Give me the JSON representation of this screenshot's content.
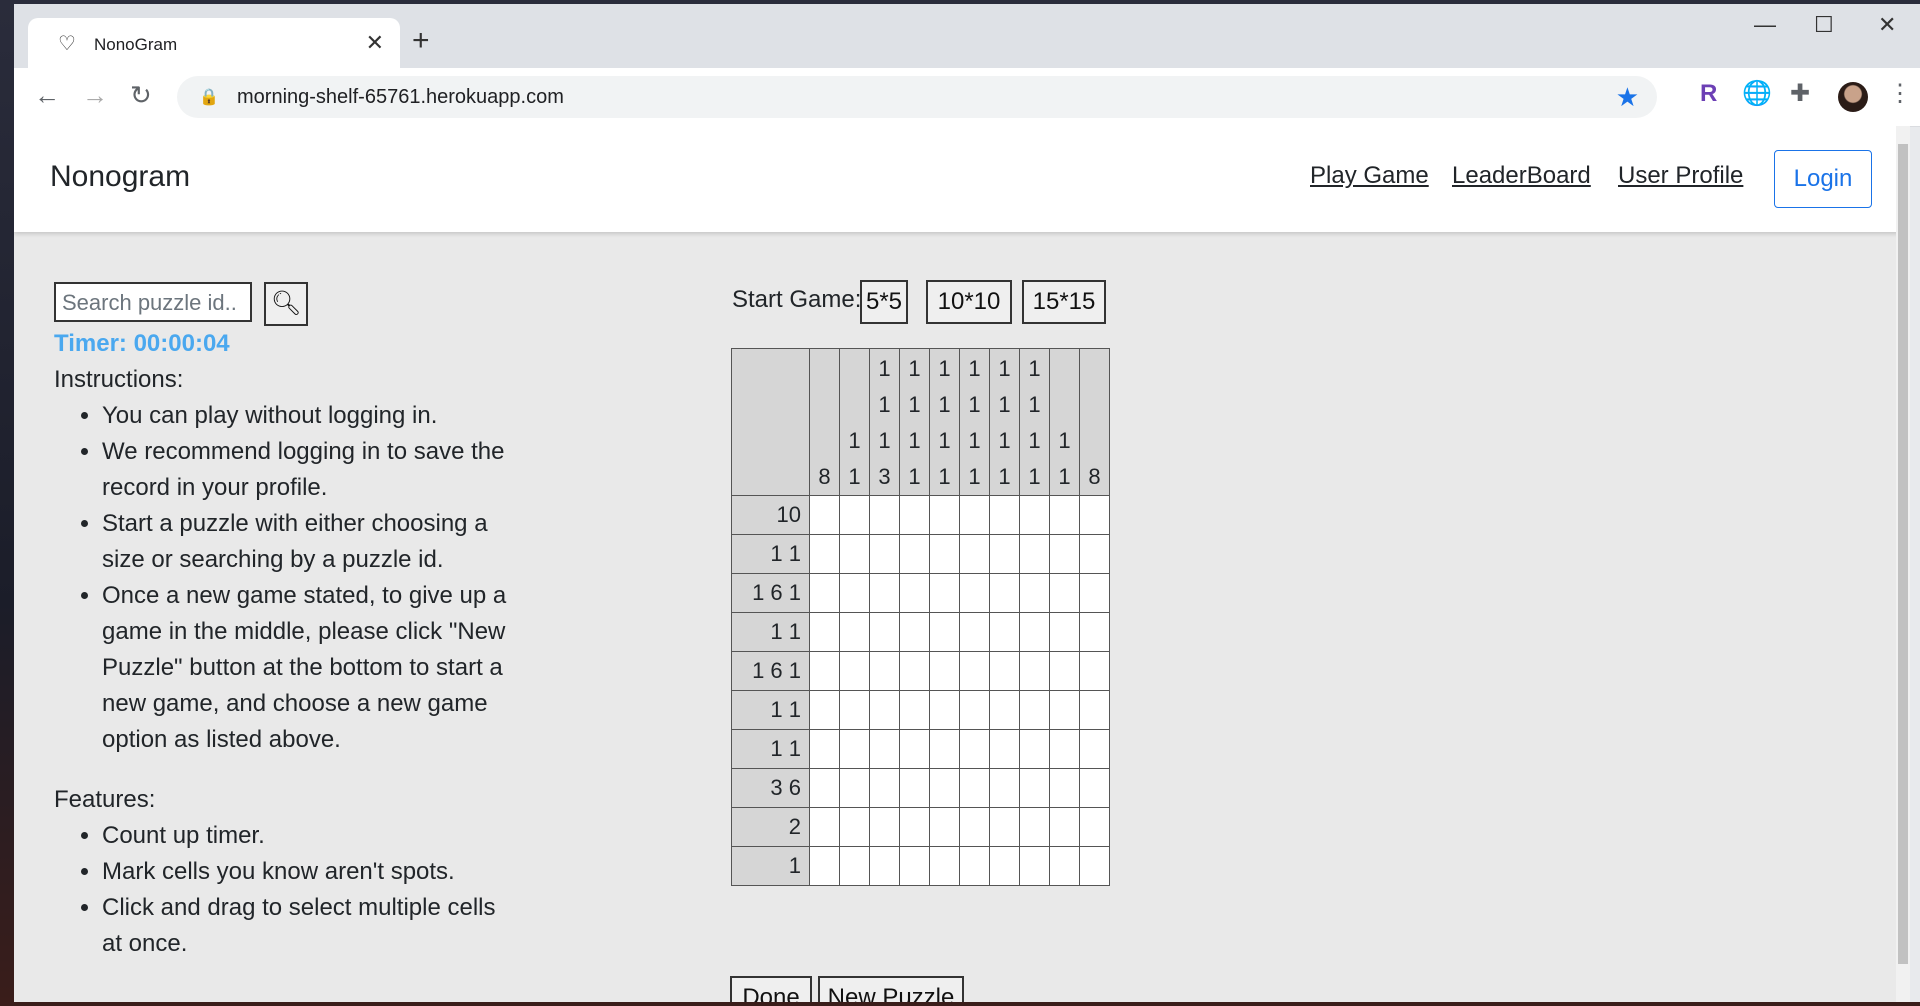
{
  "browser": {
    "tab_title": "NonoGram",
    "url": "morning-shelf-65761.herokuapp.com"
  },
  "navbar": {
    "brand": "Nonogram",
    "links": [
      "Play Game",
      "LeaderBoard",
      "User Profile"
    ],
    "login": "Login"
  },
  "search": {
    "placeholder": "Search puzzle id.."
  },
  "timer": "Timer: 00:00:04",
  "instructions": {
    "heading": "Instructions:",
    "items": [
      "You can play without logging in.",
      "We recommend logging in to save the record in your profile.",
      "Start a puzzle with either choosing a size or searching by a puzzle id.",
      "Once a new game stated, to give up a game in the middle, please click \"New Puzzle\" button at the bottom to start a new game, and choose a new game option as listed above."
    ]
  },
  "features": {
    "heading": "Features:",
    "items": [
      "Count up timer.",
      "Mark cells you know aren't spots.",
      "Click and drag to select multiple cells at once."
    ]
  },
  "start_game": {
    "label": "Start Game:",
    "sizes": [
      "5*5",
      "10*10",
      "15*15"
    ]
  },
  "puzzle": {
    "column_clues": [
      [
        "8"
      ],
      [
        "1",
        "1"
      ],
      [
        "1",
        "1",
        "1",
        "3"
      ],
      [
        "1",
        "1",
        "1",
        "1"
      ],
      [
        "1",
        "1",
        "1",
        "1"
      ],
      [
        "1",
        "1",
        "1",
        "1"
      ],
      [
        "1",
        "1",
        "1",
        "1"
      ],
      [
        "1",
        "1",
        "1",
        "1"
      ],
      [
        "1",
        "1"
      ],
      [
        "8"
      ]
    ],
    "row_clues": [
      "10",
      "1 1",
      "1 6 1",
      "1 1",
      "1 6 1",
      "1 1",
      "1 1",
      "3 6",
      "2",
      "1"
    ]
  },
  "bottom_buttons": {
    "done": "Done",
    "new_puzzle": "New Puzzle"
  }
}
